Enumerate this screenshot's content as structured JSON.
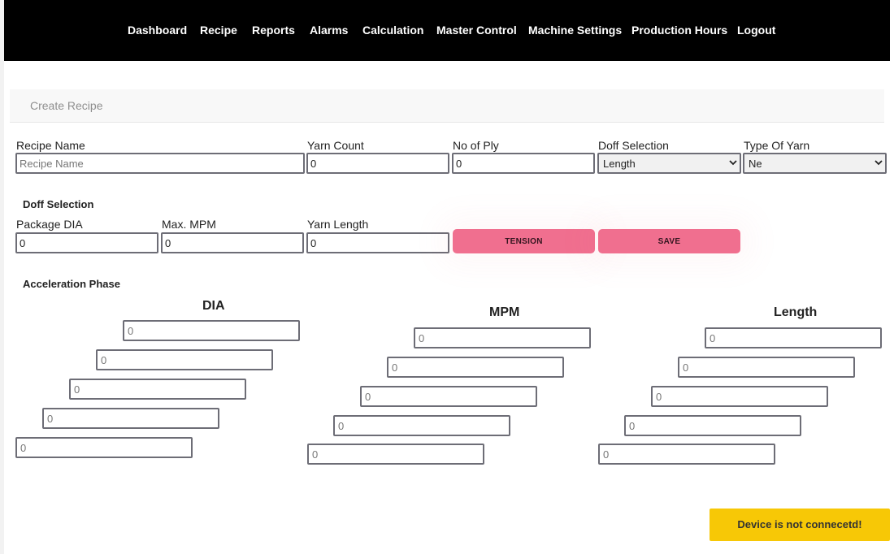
{
  "nav": {
    "items": [
      "Dashboard",
      "Recipe",
      "Reports",
      "Alarms",
      "Calculation",
      "Master Control",
      "Machine Settings",
      "Production Hours",
      "Logout"
    ]
  },
  "breadcrumb": {
    "title": "Create Recipe"
  },
  "recipe": {
    "recipe_name_label": "Recipe Name",
    "recipe_name_placeholder": "Recipe Name",
    "recipe_name_value": "",
    "yarn_count_label": "Yarn Count",
    "yarn_count_value": "0",
    "no_of_ply_label": "No of Ply",
    "no_of_ply_value": "0",
    "doff_selection_label": "Doff Selection",
    "doff_selection_value": "Length",
    "type_of_yarn_label": "Type Of Yarn",
    "type_of_yarn_value": "Ne"
  },
  "doff": {
    "section_title": "Doff Selection",
    "package_dia_label": "Package DIA",
    "package_dia_value": "0",
    "max_mpm_label": "Max. MPM",
    "max_mpm_value": "0",
    "yarn_length_label": "Yarn Length",
    "yarn_length_value": "0",
    "tension_button": "TENSION",
    "save_button": "SAVE"
  },
  "acceleration": {
    "section_title": "Acceleration Phase",
    "dia_header": "DIA",
    "mpm_header": "MPM",
    "length_header": "Length",
    "dia_values": [
      "0",
      "0",
      "0",
      "0",
      "0"
    ],
    "mpm_values": [
      "0",
      "0",
      "0",
      "0",
      "0"
    ],
    "length_values": [
      "0",
      "0",
      "0",
      "0",
      "0"
    ]
  },
  "toast": {
    "message": "Device is not connecetd!"
  },
  "colors": {
    "navbar": "#000000",
    "button_pink": "#f06f8f",
    "toast_yellow": "#f7c806"
  }
}
